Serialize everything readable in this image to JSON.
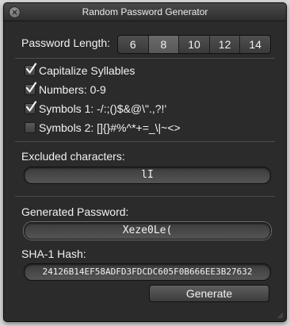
{
  "window": {
    "title": "Random Password Generator"
  },
  "password_length": {
    "label": "Password Length:",
    "options": [
      "6",
      "8",
      "10",
      "12",
      "14"
    ],
    "selected": "8"
  },
  "options": [
    {
      "label": "Capitalize Syllables",
      "checked": true
    },
    {
      "label": "Numbers: 0-9",
      "checked": true
    },
    {
      "label": "Symbols 1: -/:;()$&@\\\".,?!'",
      "checked": true
    },
    {
      "label": "Symbols 2: []{}#%^*+=_\\|~<>",
      "checked": false
    }
  ],
  "excluded": {
    "label": "Excluded characters:",
    "value": "lI"
  },
  "generated": {
    "label": "Generated Password:",
    "value": "Xeze0Le("
  },
  "hash": {
    "label": "SHA-1 Hash:",
    "value": "24126B14EF58ADFD3FDCDC605F0B666EE3B27632"
  },
  "generate_button": {
    "label": "Generate"
  },
  "colors": {
    "window_bg": "#2b2b2b",
    "text": "#f2f2f2",
    "selected_segment": "#626262"
  }
}
